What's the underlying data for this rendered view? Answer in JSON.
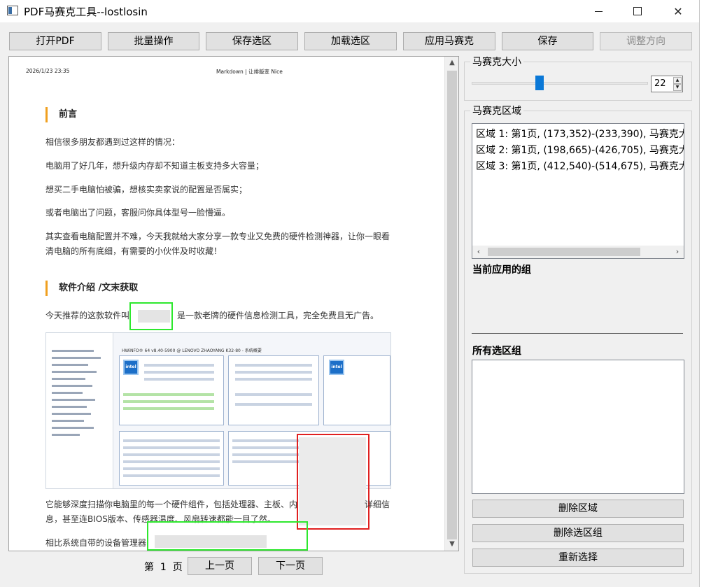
{
  "window": {
    "title": "PDF马赛克工具--lostlosin"
  },
  "toolbar": {
    "open_pdf": "打开PDF",
    "batch": "批量操作",
    "save_selection": "保存选区",
    "load_selection": "加载选区",
    "apply_mosaic": "应用马赛克",
    "save": "保存",
    "adjust_direction": "调整方向"
  },
  "document": {
    "date": "2026/1/23 23:35",
    "site": "Markdown | 让排版变 Nice",
    "heading_1": "前言",
    "p1": "相信很多朋友都遇到过这样的情况：",
    "p2": "电脑用了好几年，想升级内存却不知道主板支持多大容量；",
    "p3": "想买二手电脑怕被骗，想核实卖家说的配置是否属实；",
    "p4": "或者电脑出了问题，客服问你具体型号一脸懵逼。",
    "p5a": "其实查看电脑配置并不难，今天我就给大家分享一款专业又免费的硬件检测神器，让你一眼看",
    "p5b": "清电脑的所有底细，有需要的小伙伴及时收藏！",
    "heading_2": "软件介绍 /文末获取",
    "p6a": "今天推荐的这款软件叫",
    "p6b": "是一款老牌的硬件信息检测工具，完全免费且无广告。",
    "screenshot_title": "HWiNFO® 64 v8.40-5900 @ LENOVO ZHAOYANG K32-80 - 系统概要",
    "intel_label": "intel",
    "p7a": "它能够深度扫描你电脑里的每一个硬件组件，包括处理器、主板、内",
    "p7b": "详细信",
    "p8": "息，甚至连BIOS版本、传感器温度、风扇转速都能一目了然。",
    "p9": "相比系统自带的设备管理器"
  },
  "pager": {
    "page_prefix": "第",
    "page_number": "1",
    "page_suffix": "页",
    "prev": "上一页",
    "next": "下一页"
  },
  "mosaic_size": {
    "title": "马赛克大小",
    "value": "22",
    "slider_fraction": 0.38
  },
  "mosaic_regions": {
    "title": "马赛克区域",
    "items": [
      "区域 1: 第1页, (173,352)-(233,390), 马赛克大",
      "区域 2: 第1页, (198,665)-(426,705), 马赛克大",
      "区域 3: 第1页, (412,540)-(514,675), 马赛克大"
    ]
  },
  "current_group": {
    "title": "当前应用的组"
  },
  "all_groups": {
    "title": "所有选区组"
  },
  "actions": {
    "delete_region": "删除区域",
    "delete_group": "删除选区组",
    "reselect": "重新选择"
  },
  "colors": {
    "accent_blue": "#0a78d7",
    "mark_green": "#2ee82e",
    "mark_red": "#e02020",
    "heading_bar": "#f0a020"
  }
}
